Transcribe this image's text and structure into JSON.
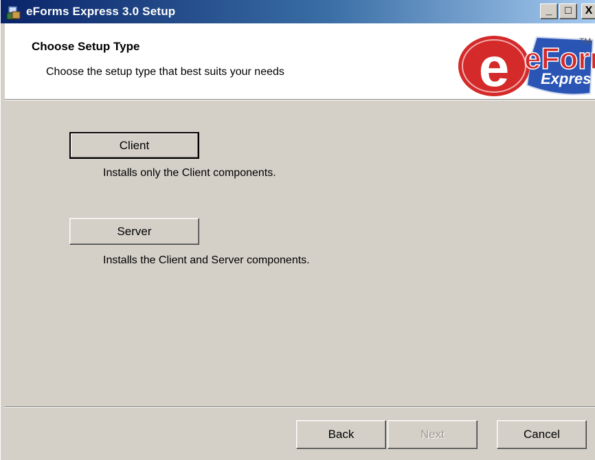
{
  "window": {
    "title": "eForms Express 3.0 Setup",
    "controls": {
      "minimize": "_",
      "maximize": "□",
      "close": "X"
    }
  },
  "banner": {
    "title": "Choose Setup Type",
    "subtitle": "Choose the setup type that best suits your needs",
    "logo": {
      "text_main": "eForms",
      "text_sub": "Express",
      "trademark": "TM"
    }
  },
  "options": [
    {
      "label": "Client",
      "description": "Installs only the Client components."
    },
    {
      "label": "Server",
      "description": "Installs the Client and Server components."
    }
  ],
  "footer": {
    "back_label": "Back",
    "next_label": "Next",
    "cancel_label": "Cancel"
  },
  "colors": {
    "titlebar_start": "#0a246a",
    "titlebar_end": "#a6caf0",
    "dialog_face": "#d4d0c8",
    "logo_red": "#d42a2a",
    "logo_blue": "#2a55b5"
  }
}
